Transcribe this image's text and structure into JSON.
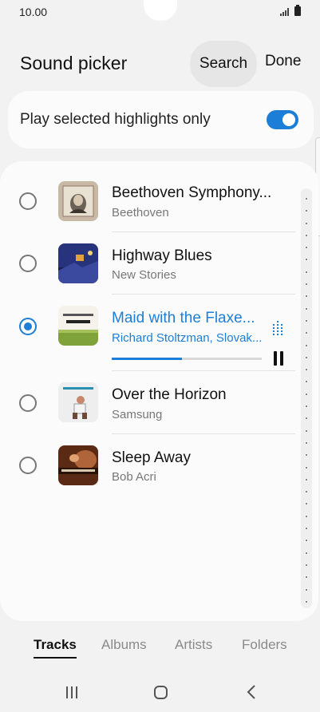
{
  "status_bar": {
    "time": "10.00"
  },
  "header": {
    "title": "Sound picker",
    "search_label": "Search",
    "done_label": "Done"
  },
  "highlights": {
    "label": "Play selected highlights only",
    "enabled": true
  },
  "tracks": [
    {
      "title": "Beethoven Symphony...",
      "artist": "Beethoven",
      "selected": false,
      "art": "beethoven-portrait"
    },
    {
      "title": "Highway Blues",
      "artist": "New Stories",
      "selected": false,
      "art": "blue-night-cover"
    },
    {
      "title": "Maid with the Flaxe...",
      "artist": "Richard Stoltzman, Slovak...",
      "selected": true,
      "art": "richard-stoltzman-cover",
      "progress": 0.47
    },
    {
      "title": "Over the Horizon",
      "artist": "Samsung",
      "selected": false,
      "art": "over-the-horizon-cover"
    },
    {
      "title": "Sleep Away",
      "artist": "Bob Acri",
      "selected": false,
      "art": "piano-cover"
    }
  ],
  "tabs": [
    {
      "label": "Tracks",
      "active": true
    },
    {
      "label": "Albums",
      "active": false
    },
    {
      "label": "Artists",
      "active": false
    },
    {
      "label": "Folders",
      "active": false
    }
  ],
  "colors": {
    "accent": "#1d7ed8",
    "background": "#f2f2f2",
    "card": "#fbfbfb"
  }
}
